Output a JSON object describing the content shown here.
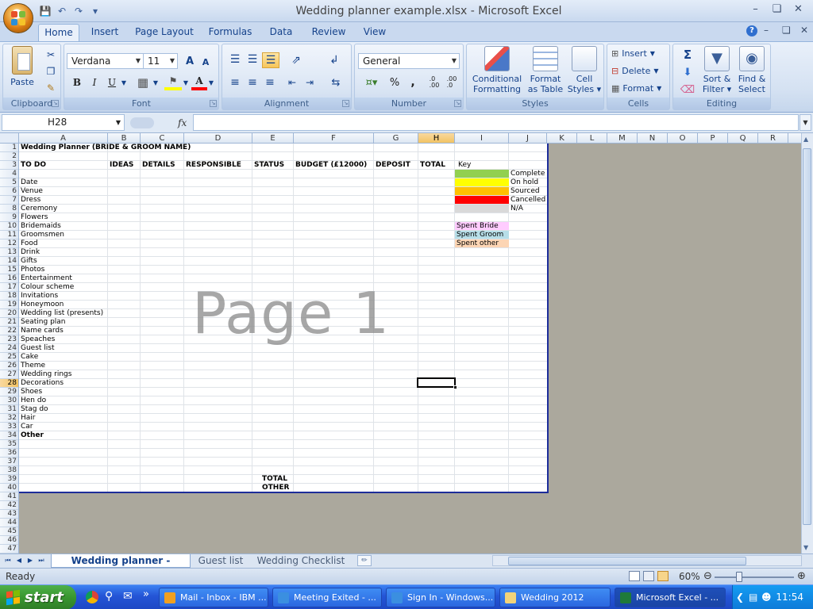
{
  "window": {
    "title": "Wedding planner example.xlsx - Microsoft Excel"
  },
  "ribbon": {
    "tabs": [
      "Home",
      "Insert",
      "Page Layout",
      "Formulas",
      "Data",
      "Review",
      "View"
    ],
    "active_tab": "Home",
    "clipboard": {
      "paste": "Paste",
      "label": "Clipboard"
    },
    "font": {
      "name": "Verdana",
      "size": "11",
      "label": "Font",
      "bold": "B",
      "italic": "I",
      "underline": "U",
      "grow": "A",
      "shrink": "A",
      "color_glyph": "A"
    },
    "alignment": {
      "label": "Alignment"
    },
    "number": {
      "format": "General",
      "label": "Number",
      "percent": "%",
      "comma": ",",
      "inc_dec": ".0\n.00",
      "dec_dec": ".00\n.0"
    },
    "styles": {
      "label": "Styles",
      "conditional": [
        "Conditional",
        "Formatting ▾"
      ],
      "format_table": [
        "Format",
        "as Table ▾"
      ],
      "cell_styles": [
        "Cell",
        "Styles ▾"
      ]
    },
    "cells": {
      "label": "Cells",
      "insert": "Insert",
      "delete": "Delete",
      "format": "Format"
    },
    "editing": {
      "label": "Editing",
      "sigma": "Σ",
      "sort": [
        "Sort &",
        "Filter ▾"
      ],
      "find": [
        "Find &",
        "Select ▾"
      ]
    }
  },
  "formula_bar": {
    "name_box": "H28",
    "fx": "fx",
    "formula": ""
  },
  "sheet": {
    "columns": [
      "A",
      "B",
      "C",
      "D",
      "E",
      "F",
      "G",
      "H",
      "I",
      "J",
      "K",
      "L",
      "M",
      "N",
      "O",
      "P",
      "Q",
      "R"
    ],
    "selected_column": "H",
    "rows": [
      "1",
      "2",
      "3",
      "4",
      "5",
      "6",
      "7",
      "8",
      "9",
      "10",
      "11",
      "12",
      "13",
      "14",
      "15",
      "16",
      "17",
      "18",
      "19",
      "20",
      "21",
      "22",
      "23",
      "24",
      "25",
      "26",
      "27",
      "28",
      "29",
      "30",
      "31",
      "32",
      "33",
      "34",
      "35",
      "36",
      "37",
      "38",
      "39",
      "40",
      "41",
      "42",
      "43",
      "44",
      "45",
      "46",
      "47"
    ],
    "selected_row": "28",
    "title": "Wedding Planner (BRIDE & GROOM NAME)",
    "headers": [
      "TO DO",
      "IDEAS",
      "DETAILS",
      "RESPONSIBLE",
      "STATUS",
      "BUDGET (£12000)",
      "DEPOSIT",
      "TOTAL"
    ],
    "todo_items": [
      "Date",
      "Venue",
      "Dress",
      "Ceremony",
      "Flowers",
      "Bridemaids",
      "Groomsmen",
      "Food",
      "Drink",
      "Gifts",
      "Photos",
      "Entertainment",
      "Colour scheme",
      "Invitations",
      "Honeymoon",
      "Wedding list (presents)",
      "Seating plan",
      "Name cards",
      "Speaches",
      "Guest list",
      "Cake",
      "Theme",
      "Wedding rings",
      "Decorations",
      "Shoes",
      "Hen do",
      "Stag do",
      "Hair",
      "Car",
      "Other"
    ],
    "totals": [
      "TOTAL",
      "OTHER"
    ],
    "key": {
      "title": "Key",
      "status": [
        {
          "label": "Complete",
          "color": "#92d050"
        },
        {
          "label": "On hold",
          "color": "#ffff00"
        },
        {
          "label": "Sourced",
          "color": "#ffc000"
        },
        {
          "label": "Cancelled",
          "color": "#ff0000"
        },
        {
          "label": "N/A",
          "color": "#d9d9d9"
        }
      ],
      "spent": [
        {
          "label": "Spent Bride",
          "color": "#ffccff"
        },
        {
          "label": "Spent Groom",
          "color": "#b7dee8"
        },
        {
          "label": "Spent other",
          "color": "#fcd5b4"
        }
      ]
    },
    "watermark": "Page 1"
  },
  "sheet_tabs": [
    "Wedding planner - budget",
    "Guest list",
    "Wedding Checklist"
  ],
  "active_sheet_tab": "Wedding planner - budget",
  "status": {
    "text": "Ready",
    "zoom": "60%"
  },
  "taskbar": {
    "start": "start",
    "tasks": [
      "Mail - Inbox - IBM ...",
      "Meeting Exited - ...",
      "Sign In - Windows...",
      "Wedding 2012",
      "Microsoft Excel - ..."
    ],
    "active_task": "Microsoft Excel - ...",
    "clock": "11:54"
  }
}
